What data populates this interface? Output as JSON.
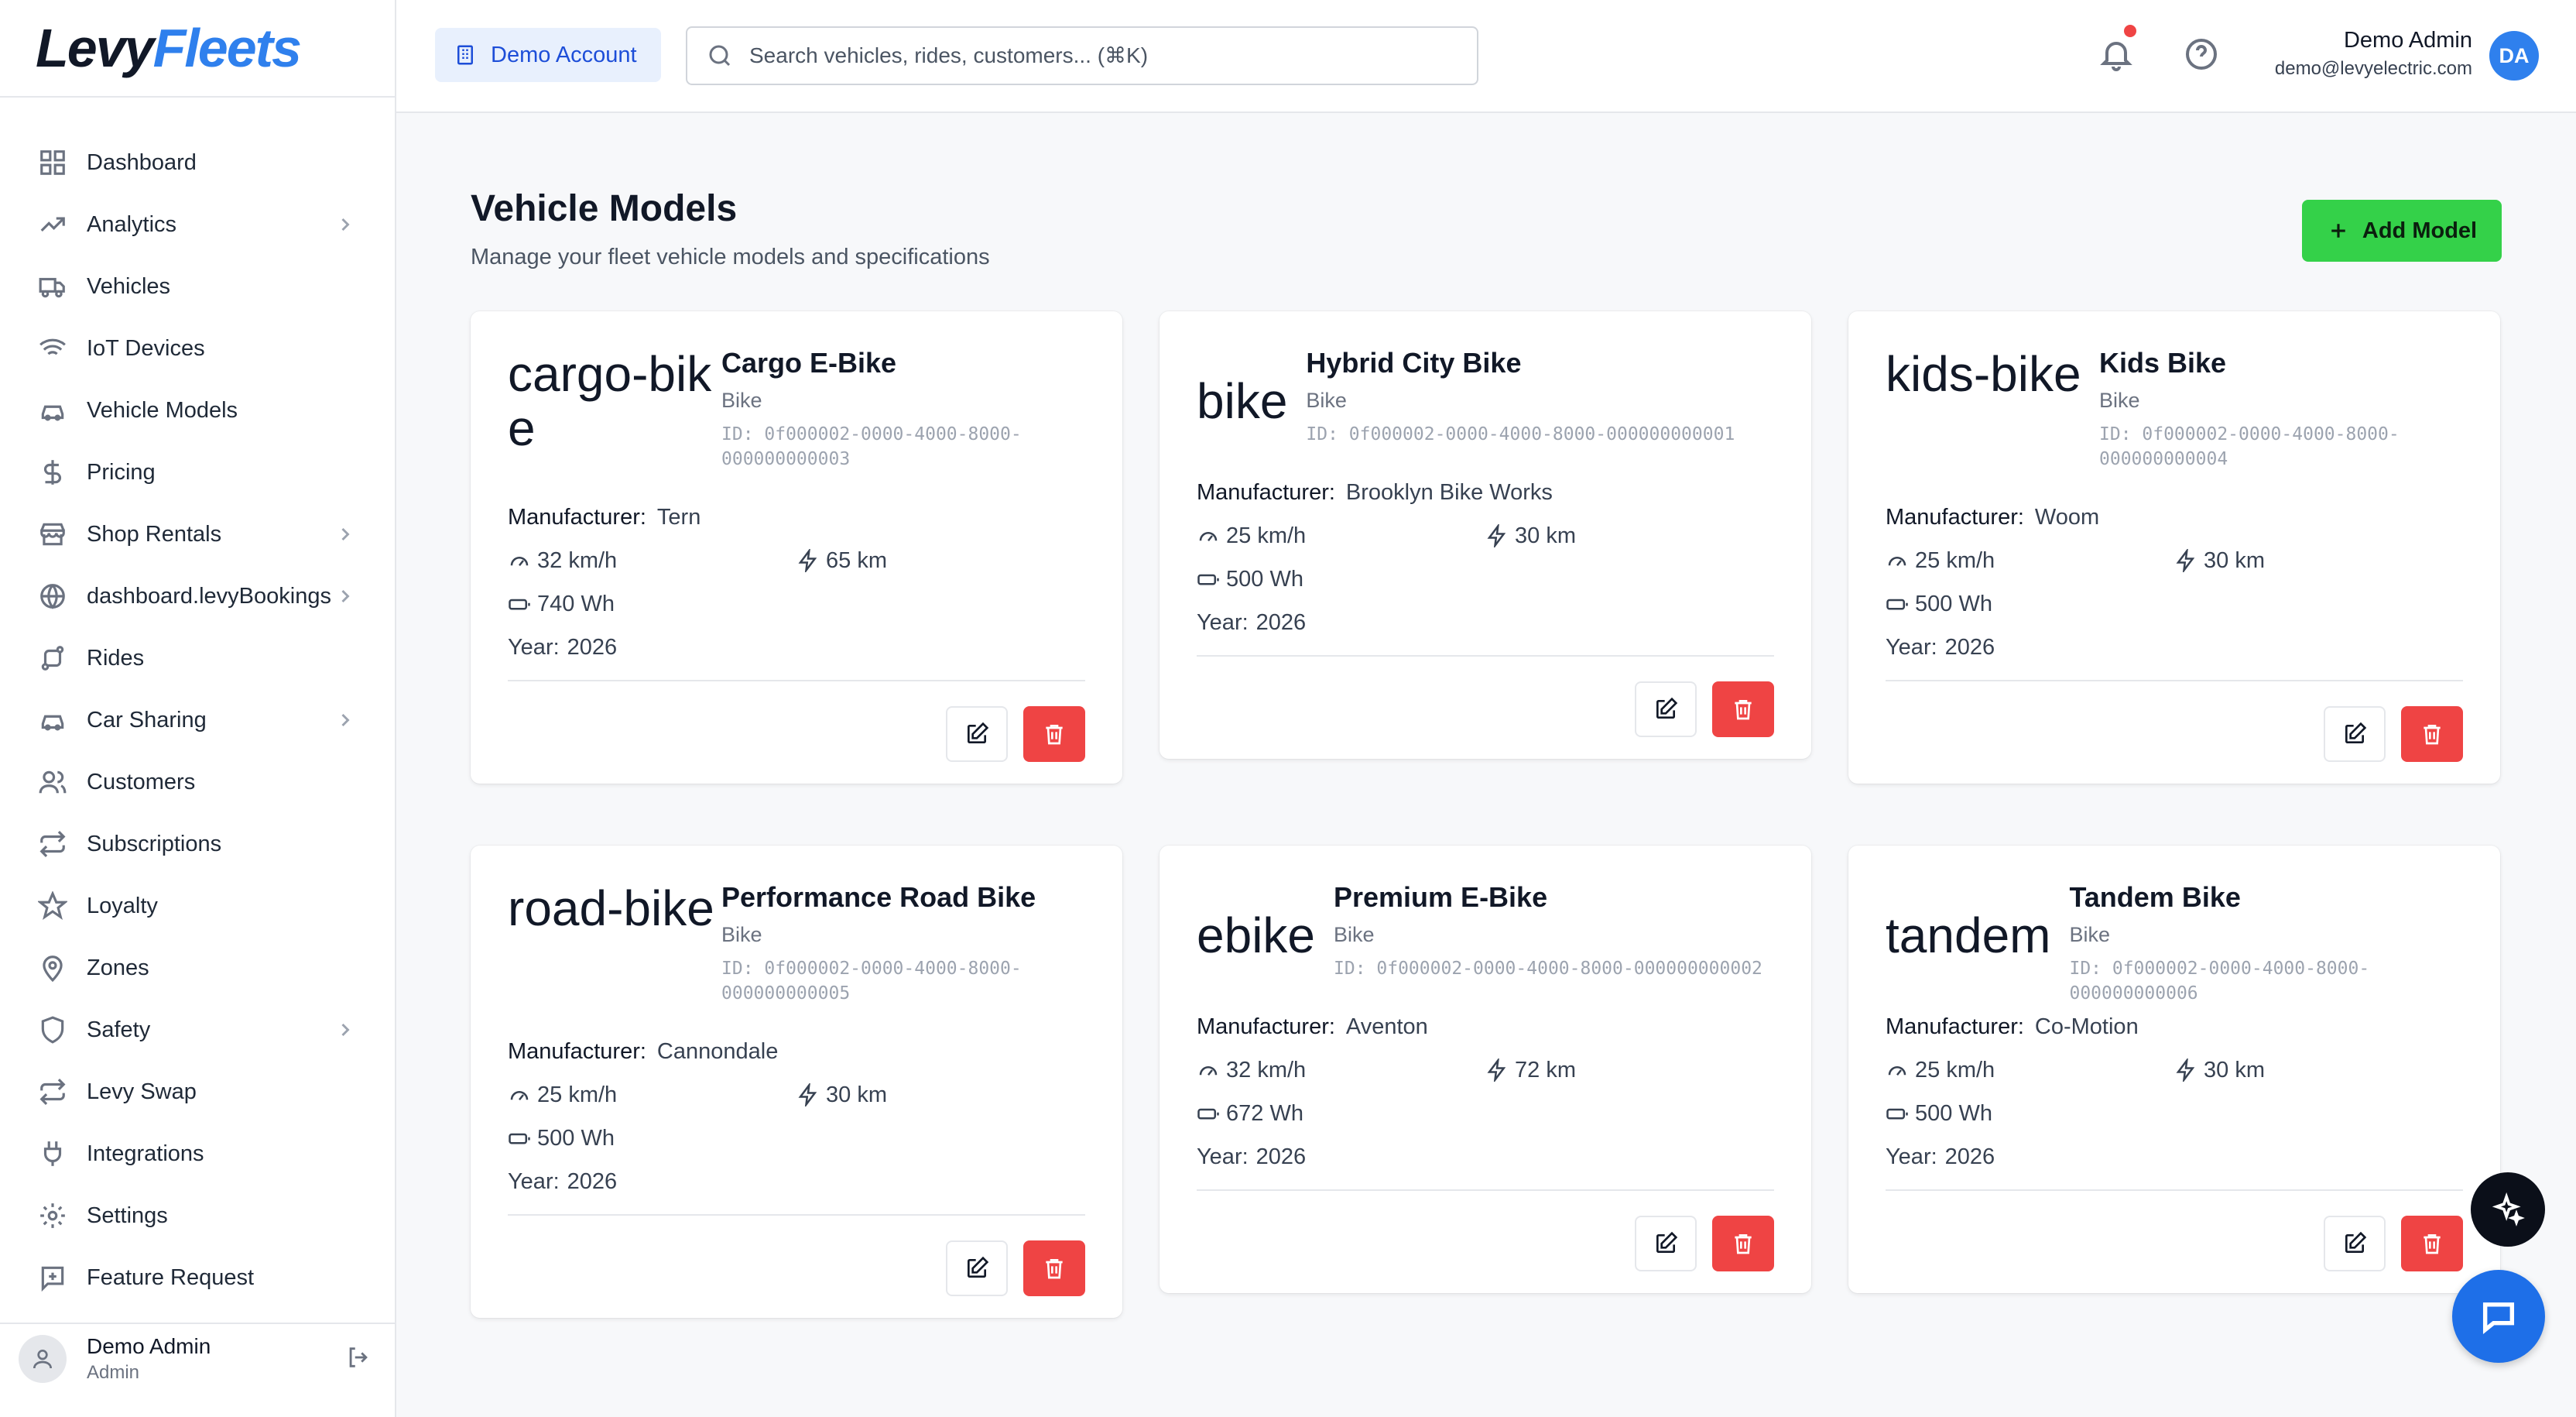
{
  "brand": {
    "part1": "Levy",
    "part2": "Fleets"
  },
  "sidebar": {
    "items": [
      {
        "label": "Dashboard",
        "icon": "grid-icon",
        "chevron": false
      },
      {
        "label": "Analytics",
        "icon": "trending-up-icon",
        "chevron": true
      },
      {
        "label": "Vehicles",
        "icon": "truck-icon",
        "chevron": false
      },
      {
        "label": "IoT Devices",
        "icon": "wifi-icon",
        "chevron": false
      },
      {
        "label": "Vehicle Models",
        "icon": "car-icon",
        "chevron": false
      },
      {
        "label": "Pricing",
        "icon": "dollar-icon",
        "chevron": false
      },
      {
        "label": "Shop Rentals",
        "icon": "store-icon",
        "chevron": true
      },
      {
        "label": "dashboard.levyBookings",
        "icon": "globe-icon",
        "chevron": true
      },
      {
        "label": "Rides",
        "icon": "route-icon",
        "chevron": false
      },
      {
        "label": "Car Sharing",
        "icon": "car-icon",
        "chevron": true
      },
      {
        "label": "Customers",
        "icon": "users-icon",
        "chevron": false
      },
      {
        "label": "Subscriptions",
        "icon": "repeat-icon",
        "chevron": false
      },
      {
        "label": "Loyalty",
        "icon": "star-icon",
        "chevron": false
      },
      {
        "label": "Zones",
        "icon": "map-pin-icon",
        "chevron": false
      },
      {
        "label": "Safety",
        "icon": "shield-icon",
        "chevron": true
      },
      {
        "label": "Levy Swap",
        "icon": "repeat-icon",
        "chevron": false
      },
      {
        "label": "Integrations",
        "icon": "plug-icon",
        "chevron": false
      },
      {
        "label": "Settings",
        "icon": "gear-icon",
        "chevron": false
      },
      {
        "label": "Feature Request",
        "icon": "message-plus-icon",
        "chevron": false
      }
    ],
    "footer": {
      "name": "Demo Admin",
      "role": "Admin"
    }
  },
  "header": {
    "account_label": "Demo Account",
    "search_placeholder": "Search vehicles, rides, customers... (⌘K)",
    "user_name": "Demo Admin",
    "user_email": "demo@levyelectric.com",
    "avatar_initials": "DA"
  },
  "page": {
    "title": "Vehicle Models",
    "subtitle": "Manage your fleet vehicle models and specifications",
    "add_label": "Add Model"
  },
  "labels": {
    "manufacturer": "Manufacturer:",
    "year_prefix": "Year:"
  },
  "models": [
    {
      "big": "cargo-bike",
      "name": "Cargo E-Bike",
      "type": "Bike",
      "id": "ID: 0f000002-0000-4000-8000-000000000003",
      "manufacturer": "Tern",
      "speed": "32 km/h",
      "range": "65 km",
      "battery": "740 Wh",
      "year": "2026"
    },
    {
      "big": "bike",
      "name": "Hybrid City Bike",
      "type": "Bike",
      "id": "ID: 0f000002-0000-4000-8000-000000000001",
      "manufacturer": "Brooklyn Bike Works",
      "speed": "25 km/h",
      "range": "30 km",
      "battery": "500 Wh",
      "year": "2026"
    },
    {
      "big": "kids-bike",
      "name": "Kids Bike",
      "type": "Bike",
      "id": "ID: 0f000002-0000-4000-8000-000000000004",
      "manufacturer": "Woom",
      "speed": "25 km/h",
      "range": "30 km",
      "battery": "500 Wh",
      "year": "2026"
    },
    {
      "big": "road-bike",
      "name": "Performance Road Bike",
      "type": "Bike",
      "id": "ID: 0f000002-0000-4000-8000-000000000005",
      "manufacturer": "Cannondale",
      "speed": "25 km/h",
      "range": "30 km",
      "battery": "500 Wh",
      "year": "2026"
    },
    {
      "big": "ebike",
      "name": "Premium E-Bike",
      "type": "Bike",
      "id": "ID: 0f000002-0000-4000-8000-000000000002",
      "manufacturer": "Aventon",
      "speed": "32 km/h",
      "range": "72 km",
      "battery": "672 Wh",
      "year": "2026"
    },
    {
      "big": "tandem",
      "name": "Tandem Bike",
      "type": "Bike",
      "id": "ID: 0f000002-0000-4000-8000-000000000006",
      "manufacturer": "Co-Motion",
      "speed": "25 km/h",
      "range": "30 km",
      "battery": "500 Wh",
      "year": "2026"
    }
  ],
  "colors": {
    "primary": "#2f80ed",
    "add_button": "#34d149",
    "danger": "#ef4444",
    "chat_fab": "#1e6fe8"
  }
}
